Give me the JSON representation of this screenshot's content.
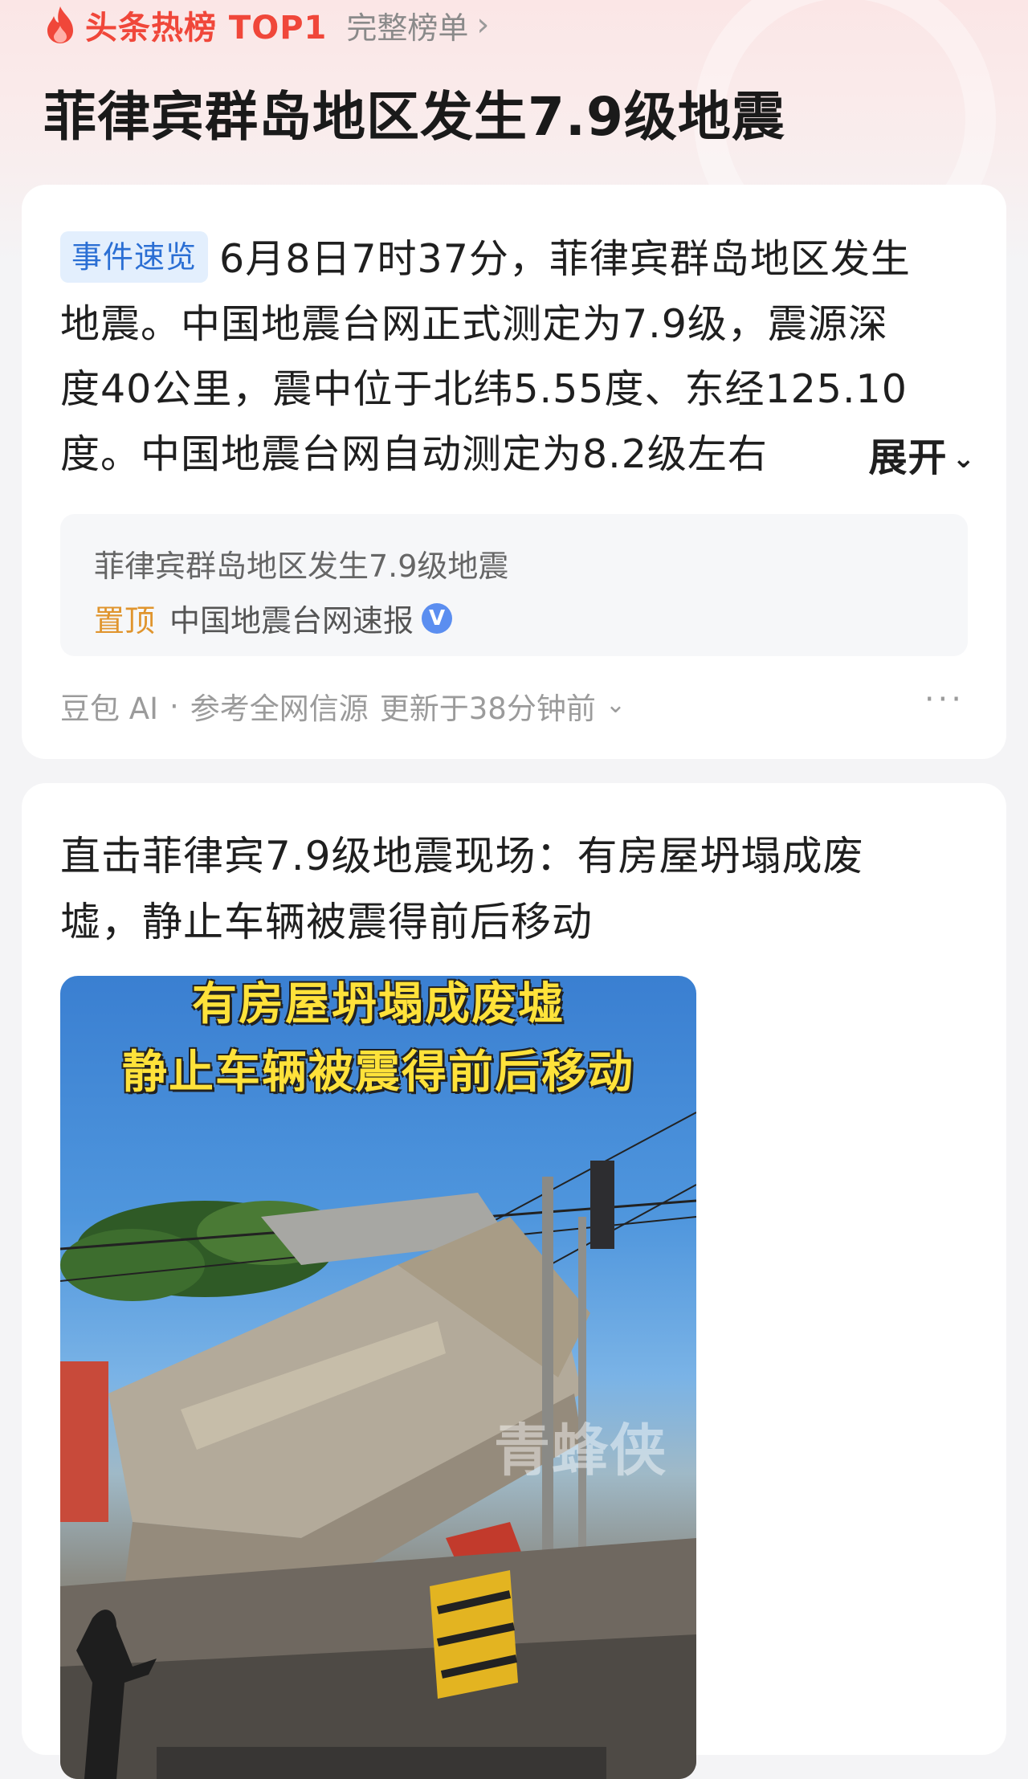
{
  "header": {
    "hot_label": "头条热榜 TOP1",
    "full_list_label": "完整榜单",
    "accent_color": "#f0473a"
  },
  "page_title": "菲律宾群岛地区发生7.9级地震",
  "summary_card": {
    "tag": "事件速览",
    "lines": [
      "6月8日7时37分，菲律宾群岛地区发生",
      "地震。中国地震台网正式测定为7.9级，震源深",
      "度40公里，震中位于北纬5.55度、东经125.10",
      "度。中国地震台网自动测定为8.2级左右"
    ],
    "expand_label": "展开",
    "source": {
      "title": "菲律宾群岛地区发生7.9级地震",
      "pinned_label": "置顶",
      "name": "中国地震台网速报",
      "verified_mark": "V"
    },
    "meta": {
      "provider": "豆包 AI",
      "dot": "·",
      "ref": "参考全网信源",
      "updated": "更新于38分钟前"
    }
  },
  "news_card": {
    "title_lines": [
      "直击菲律宾7.9级地震现场：有房屋坍塌成废",
      "墟，静止车辆被震得前后移动"
    ],
    "video": {
      "caption_1": "有房屋坍塌成废墟",
      "caption_2": "静止车辆被震得前后移动",
      "watermark": "青蜂侠"
    }
  }
}
